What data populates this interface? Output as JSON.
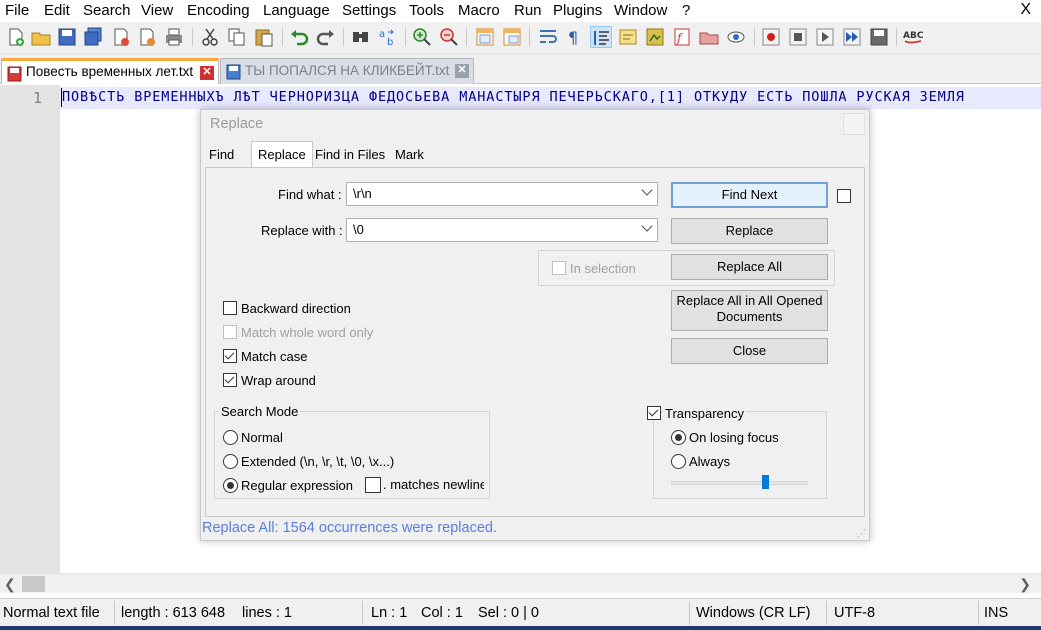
{
  "menu": [
    "File",
    "Edit",
    "Search",
    "View",
    "Encoding",
    "Language",
    "Settings",
    "Tools",
    "Macro",
    "Run",
    "Plugins",
    "Window",
    "?"
  ],
  "window_close": "X",
  "tabs": [
    {
      "label": "Повесть временных лет.txt",
      "close": "✕"
    },
    {
      "label": "ТЫ ПОПАЛСЯ НА КЛИКБЕЙТ.txt",
      "close": "✕"
    }
  ],
  "editor": {
    "line_number": "1",
    "line_text": "ПОВѢСТЬ ВРЕМЕННЫХЪ ЛѢТ ЧЕРНОРИЗЦА ФЕДОСЬЕВА МАНАСТЫРЯ ПЕЧЕРЬСКАГО,[1] ОТКУДУ ЕСТЬ ПОШЛА РУСКАЯ ЗЕМЛЯ"
  },
  "dialog": {
    "title": "Replace",
    "tabs": [
      "Find",
      "Replace",
      "Find in Files",
      "Mark"
    ],
    "find_what_label": "Find what :",
    "find_what_value": "\\r\\n",
    "replace_with_label": "Replace with :",
    "replace_with_value": "\\0",
    "in_selection_label": "In selection",
    "buttons": {
      "find_next": "Find Next",
      "replace": "Replace",
      "replace_all": "Replace All",
      "replace_all_opened_line1": "Replace All in All Opened",
      "replace_all_opened_line2": "Documents",
      "close": "Close"
    },
    "options": {
      "backward_direction": "Backward direction",
      "match_whole_word": "Match whole word only",
      "match_case": "Match case",
      "wrap_around": "Wrap around"
    },
    "search_mode": {
      "title": "Search Mode",
      "normal": "Normal",
      "extended": "Extended (\\n, \\r, \\t, \\0, \\x...)",
      "regex": "Regular expression",
      "matches_newline": ". matches newline"
    },
    "transparency": {
      "title": "Transparency",
      "on_losing_focus": "On losing focus",
      "always": "Always",
      "level": 0.7
    },
    "status_message": "Replace All: 1564 occurrences were replaced."
  },
  "statusbar": {
    "file_type": "Normal text file",
    "length": "length : 613 648",
    "lines": "lines : 1",
    "ln": "Ln : 1",
    "col": "Col : 1",
    "sel": "Sel : 0 | 0",
    "eol": "Windows (CR LF)",
    "encoding": "UTF-8",
    "mode": "INS"
  },
  "colors": {
    "active_tab_accent": "#f8a940",
    "editor_text": "#00008b",
    "line_highlight": "#e8e8ff",
    "status_message": "#5a7fd8",
    "slider": "#0078d7"
  }
}
